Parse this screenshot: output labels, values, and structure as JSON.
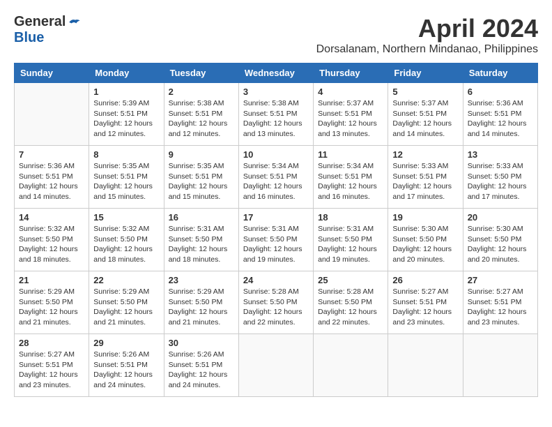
{
  "header": {
    "logo_general": "General",
    "logo_blue": "Blue",
    "month": "April 2024",
    "location": "Dorsalanam, Northern Mindanao, Philippines"
  },
  "weekdays": [
    "Sunday",
    "Monday",
    "Tuesday",
    "Wednesday",
    "Thursday",
    "Friday",
    "Saturday"
  ],
  "weeks": [
    [
      {
        "day": "",
        "sunrise": "",
        "sunset": "",
        "daylight": ""
      },
      {
        "day": "1",
        "sunrise": "Sunrise: 5:39 AM",
        "sunset": "Sunset: 5:51 PM",
        "daylight": "Daylight: 12 hours and 12 minutes."
      },
      {
        "day": "2",
        "sunrise": "Sunrise: 5:38 AM",
        "sunset": "Sunset: 5:51 PM",
        "daylight": "Daylight: 12 hours and 12 minutes."
      },
      {
        "day": "3",
        "sunrise": "Sunrise: 5:38 AM",
        "sunset": "Sunset: 5:51 PM",
        "daylight": "Daylight: 12 hours and 13 minutes."
      },
      {
        "day": "4",
        "sunrise": "Sunrise: 5:37 AM",
        "sunset": "Sunset: 5:51 PM",
        "daylight": "Daylight: 12 hours and 13 minutes."
      },
      {
        "day": "5",
        "sunrise": "Sunrise: 5:37 AM",
        "sunset": "Sunset: 5:51 PM",
        "daylight": "Daylight: 12 hours and 14 minutes."
      },
      {
        "day": "6",
        "sunrise": "Sunrise: 5:36 AM",
        "sunset": "Sunset: 5:51 PM",
        "daylight": "Daylight: 12 hours and 14 minutes."
      }
    ],
    [
      {
        "day": "7",
        "sunrise": "Sunrise: 5:36 AM",
        "sunset": "Sunset: 5:51 PM",
        "daylight": "Daylight: 12 hours and 14 minutes."
      },
      {
        "day": "8",
        "sunrise": "Sunrise: 5:35 AM",
        "sunset": "Sunset: 5:51 PM",
        "daylight": "Daylight: 12 hours and 15 minutes."
      },
      {
        "day": "9",
        "sunrise": "Sunrise: 5:35 AM",
        "sunset": "Sunset: 5:51 PM",
        "daylight": "Daylight: 12 hours and 15 minutes."
      },
      {
        "day": "10",
        "sunrise": "Sunrise: 5:34 AM",
        "sunset": "Sunset: 5:51 PM",
        "daylight": "Daylight: 12 hours and 16 minutes."
      },
      {
        "day": "11",
        "sunrise": "Sunrise: 5:34 AM",
        "sunset": "Sunset: 5:51 PM",
        "daylight": "Daylight: 12 hours and 16 minutes."
      },
      {
        "day": "12",
        "sunrise": "Sunrise: 5:33 AM",
        "sunset": "Sunset: 5:51 PM",
        "daylight": "Daylight: 12 hours and 17 minutes."
      },
      {
        "day": "13",
        "sunrise": "Sunrise: 5:33 AM",
        "sunset": "Sunset: 5:50 PM",
        "daylight": "Daylight: 12 hours and 17 minutes."
      }
    ],
    [
      {
        "day": "14",
        "sunrise": "Sunrise: 5:32 AM",
        "sunset": "Sunset: 5:50 PM",
        "daylight": "Daylight: 12 hours and 18 minutes."
      },
      {
        "day": "15",
        "sunrise": "Sunrise: 5:32 AM",
        "sunset": "Sunset: 5:50 PM",
        "daylight": "Daylight: 12 hours and 18 minutes."
      },
      {
        "day": "16",
        "sunrise": "Sunrise: 5:31 AM",
        "sunset": "Sunset: 5:50 PM",
        "daylight": "Daylight: 12 hours and 18 minutes."
      },
      {
        "day": "17",
        "sunrise": "Sunrise: 5:31 AM",
        "sunset": "Sunset: 5:50 PM",
        "daylight": "Daylight: 12 hours and 19 minutes."
      },
      {
        "day": "18",
        "sunrise": "Sunrise: 5:31 AM",
        "sunset": "Sunset: 5:50 PM",
        "daylight": "Daylight: 12 hours and 19 minutes."
      },
      {
        "day": "19",
        "sunrise": "Sunrise: 5:30 AM",
        "sunset": "Sunset: 5:50 PM",
        "daylight": "Daylight: 12 hours and 20 minutes."
      },
      {
        "day": "20",
        "sunrise": "Sunrise: 5:30 AM",
        "sunset": "Sunset: 5:50 PM",
        "daylight": "Daylight: 12 hours and 20 minutes."
      }
    ],
    [
      {
        "day": "21",
        "sunrise": "Sunrise: 5:29 AM",
        "sunset": "Sunset: 5:50 PM",
        "daylight": "Daylight: 12 hours and 21 minutes."
      },
      {
        "day": "22",
        "sunrise": "Sunrise: 5:29 AM",
        "sunset": "Sunset: 5:50 PM",
        "daylight": "Daylight: 12 hours and 21 minutes."
      },
      {
        "day": "23",
        "sunrise": "Sunrise: 5:29 AM",
        "sunset": "Sunset: 5:50 PM",
        "daylight": "Daylight: 12 hours and 21 minutes."
      },
      {
        "day": "24",
        "sunrise": "Sunrise: 5:28 AM",
        "sunset": "Sunset: 5:50 PM",
        "daylight": "Daylight: 12 hours and 22 minutes."
      },
      {
        "day": "25",
        "sunrise": "Sunrise: 5:28 AM",
        "sunset": "Sunset: 5:50 PM",
        "daylight": "Daylight: 12 hours and 22 minutes."
      },
      {
        "day": "26",
        "sunrise": "Sunrise: 5:27 AM",
        "sunset": "Sunset: 5:51 PM",
        "daylight": "Daylight: 12 hours and 23 minutes."
      },
      {
        "day": "27",
        "sunrise": "Sunrise: 5:27 AM",
        "sunset": "Sunset: 5:51 PM",
        "daylight": "Daylight: 12 hours and 23 minutes."
      }
    ],
    [
      {
        "day": "28",
        "sunrise": "Sunrise: 5:27 AM",
        "sunset": "Sunset: 5:51 PM",
        "daylight": "Daylight: 12 hours and 23 minutes."
      },
      {
        "day": "29",
        "sunrise": "Sunrise: 5:26 AM",
        "sunset": "Sunset: 5:51 PM",
        "daylight": "Daylight: 12 hours and 24 minutes."
      },
      {
        "day": "30",
        "sunrise": "Sunrise: 5:26 AM",
        "sunset": "Sunset: 5:51 PM",
        "daylight": "Daylight: 12 hours and 24 minutes."
      },
      {
        "day": "",
        "sunrise": "",
        "sunset": "",
        "daylight": ""
      },
      {
        "day": "",
        "sunrise": "",
        "sunset": "",
        "daylight": ""
      },
      {
        "day": "",
        "sunrise": "",
        "sunset": "",
        "daylight": ""
      },
      {
        "day": "",
        "sunrise": "",
        "sunset": "",
        "daylight": ""
      }
    ]
  ]
}
